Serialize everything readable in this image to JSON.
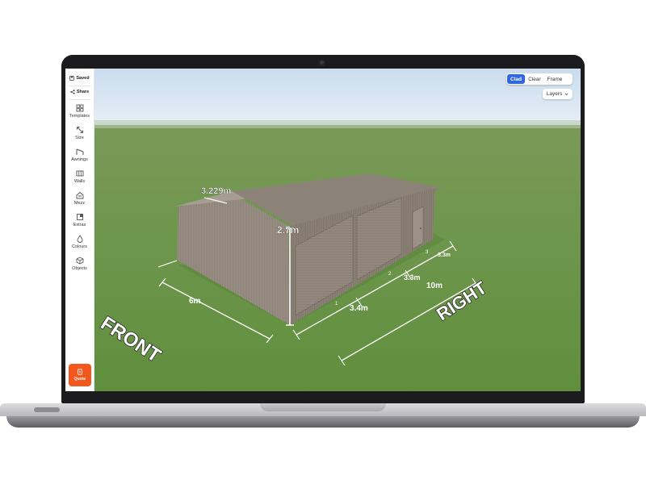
{
  "sidebar": {
    "saved": "Saved",
    "share": "Share",
    "items": [
      {
        "label": "Templates",
        "icon": "grid-icon"
      },
      {
        "label": "Size",
        "icon": "resize-arrow-icon"
      },
      {
        "label": "Awnings",
        "icon": "awning-icon"
      },
      {
        "label": "Walls",
        "icon": "walls-icon"
      },
      {
        "label": "Mezz",
        "icon": "mezzanine-icon"
      },
      {
        "label": "Extras",
        "icon": "extras-icon"
      },
      {
        "label": "Colours",
        "icon": "drop-icon"
      },
      {
        "label": "Objects",
        "icon": "cube-icon"
      }
    ],
    "quote": "Quote"
  },
  "view_toggle": {
    "options": [
      "Clad",
      "Clear",
      "Frame"
    ],
    "active": "Clad"
  },
  "layers": {
    "label": "Layers"
  },
  "scene": {
    "labels": {
      "front": "FRONT",
      "right": "RIGHT",
      "span": "3.229m",
      "height": "2.7m",
      "width": "6m",
      "bay1": "3.4m",
      "bay2": "3.3m",
      "bay3": "3.3m",
      "length": "10m",
      "bay_no_1": "1",
      "bay_no_2": "2",
      "bay_no_3": "3"
    },
    "colors": {
      "sky": "#dce8f3",
      "grass": "#6f9a4e",
      "shed_wall": "#8d8378",
      "shed_roof": "#938a80",
      "accent": "#3166e1",
      "quote": "#f2581e"
    }
  }
}
